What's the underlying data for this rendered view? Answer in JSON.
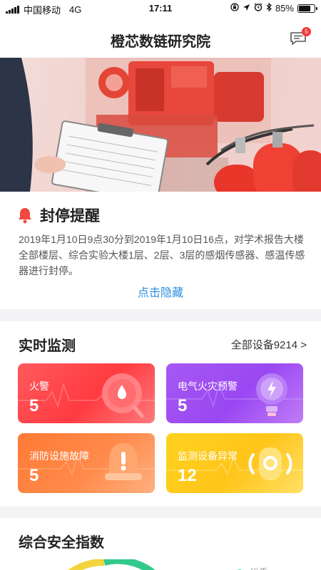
{
  "status_bar": {
    "carrier": "中国移动",
    "network": "4G",
    "time": "17:11",
    "battery_percent": "85%",
    "battery_level": 0.85,
    "icons": [
      "signal-icon",
      "screen-rotation-lock-icon",
      "location-arrow-icon",
      "alarm-icon",
      "bluetooth-icon",
      "battery-icon"
    ]
  },
  "header": {
    "title": "橙芯数链研究院",
    "message_badge": "5",
    "message_icon": "chat-bubble-icon"
  },
  "banner": {
    "image": "fire-safety-inspection-photo"
  },
  "notice": {
    "icon": "bell-icon",
    "title": "封停提醒",
    "body": "2019年1月10日9点30分到2019年1月10日16点，对学术报告大楼全部楼层、综合实验大楼1层、2层、3层的感烟传感器、感温传感器进行封停。",
    "hide_link": "点击隐藏"
  },
  "monitoring": {
    "title": "实时监测",
    "all_devices_link": "全部设备9214 >",
    "cards": [
      {
        "label": "火警",
        "count": "5",
        "icon": "fire-alarm-icon",
        "color": "#ff4a4f"
      },
      {
        "label": "电气火灾预警",
        "count": "5",
        "icon": "lightning-bulb-icon",
        "color": "#9d4cf2"
      },
      {
        "label": "消防设施故障",
        "count": "5",
        "icon": "warning-bell-icon",
        "color": "#ff8140"
      },
      {
        "label": "监测设备异常",
        "count": "12",
        "icon": "device-signal-icon",
        "color": "#ffcb1f"
      }
    ]
  },
  "safety_index": {
    "title": "综合安全指数",
    "legend": "优秀",
    "legend_color": "#2fd3b0"
  }
}
